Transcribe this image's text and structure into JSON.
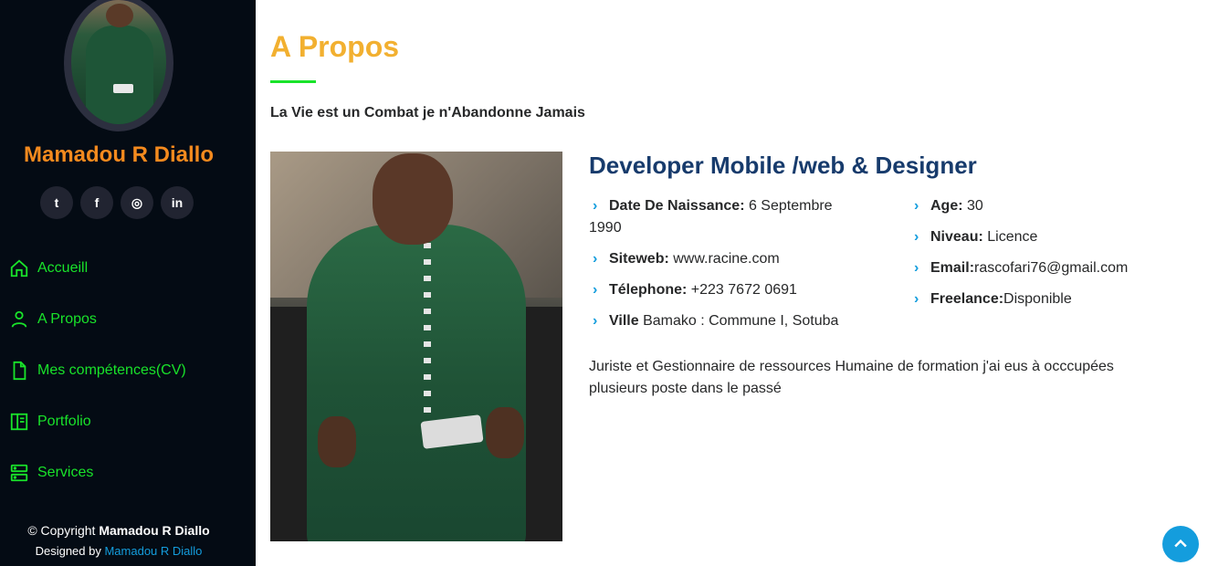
{
  "sidebar": {
    "profile_name": "Mamadou R Diallo",
    "social": [
      {
        "name": "twitter",
        "glyph": "t"
      },
      {
        "name": "facebook",
        "glyph": "f"
      },
      {
        "name": "instagram",
        "glyph": "◎"
      },
      {
        "name": "linkedin",
        "glyph": "in"
      }
    ],
    "nav": [
      {
        "label": "Accueill",
        "icon": "home-icon"
      },
      {
        "label": "A Propos",
        "icon": "person-icon"
      },
      {
        "label": "Mes compétences(CV)",
        "icon": "file-icon"
      },
      {
        "label": "Portfolio",
        "icon": "layout-icon"
      },
      {
        "label": "Services",
        "icon": "server-icon"
      }
    ],
    "footer": {
      "copyright_prefix": "© Copyright ",
      "copyright_name": "Mamadou R Diallo",
      "designed_prefix": "Designed by ",
      "designed_name": "Mamadou R Diallo"
    }
  },
  "main": {
    "section_title": "A Propos",
    "tagline": "La Vie est un Combat je n'Abandonne Jamais",
    "role": "Developer Mobile /web & Designer",
    "info_left": [
      {
        "label": "Date De Naissance:",
        "value": " 6 Septembre 1990"
      },
      {
        "label": "Siteweb:",
        "value": " www.racine.com"
      },
      {
        "label": "Télephone:",
        "value": " +223 7672 0691"
      },
      {
        "label": "Ville",
        "value": " Bamako : Commune I, Sotuba"
      }
    ],
    "info_right": [
      {
        "label": "Age:",
        "value": " 30"
      },
      {
        "label": "Niveau:",
        "value": " Licence"
      },
      {
        "label": "Email:",
        "value": "rascofari76@gmail.com"
      },
      {
        "label": "Freelance:",
        "value": "Disponible"
      }
    ],
    "description": "Juriste et Gestionnaire de ressources Humaine de formation j'ai eus à occcupées plusieurs poste dans le passé"
  },
  "colors": {
    "sidebar_bg": "#040b14",
    "name_orange": "#f48a1e",
    "nav_green": "#19e32a",
    "title_gold": "#f2b030",
    "role_blue": "#173b6c",
    "accent_blue": "#149ddd"
  }
}
